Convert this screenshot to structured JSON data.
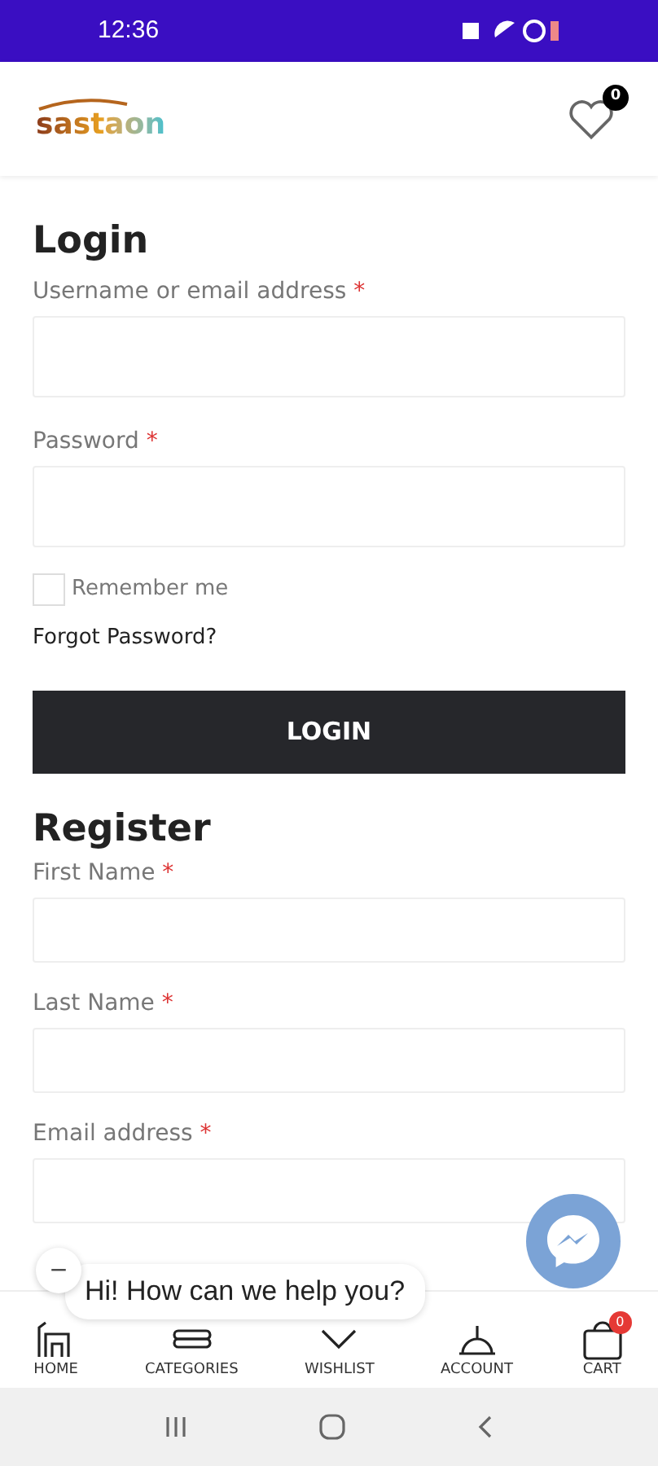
{
  "status_bar": {
    "time": "12:36"
  },
  "header": {
    "logo": "sastaon",
    "wishlist_count": "0"
  },
  "login": {
    "title": "Login",
    "fields": [
      {
        "label": "Username or email address",
        "required": "*"
      },
      {
        "label": "Password",
        "required": "*"
      }
    ],
    "remember": {
      "label": "Remember me",
      "checked": false
    },
    "forgot": "Forgot Password?",
    "button": "LOGIN"
  },
  "register": {
    "title": "Register",
    "fields": [
      {
        "label": "First Name",
        "required": "*"
      },
      {
        "label": "Last Name",
        "required": "*"
      },
      {
        "label": "Email address",
        "required": "*"
      }
    ]
  },
  "chat": {
    "greeting": "Hi! How can we help you?",
    "minimize": "−"
  },
  "bottom_nav": [
    {
      "label": "HOME",
      "kind": "home"
    },
    {
      "label": "CATEGORIES",
      "kind": "categories"
    },
    {
      "label": "WISHLIST",
      "kind": "wishlist"
    },
    {
      "label": "ACCOUNT",
      "kind": "account"
    },
    {
      "label": "CART",
      "kind": "cart",
      "badge": "0"
    }
  ]
}
